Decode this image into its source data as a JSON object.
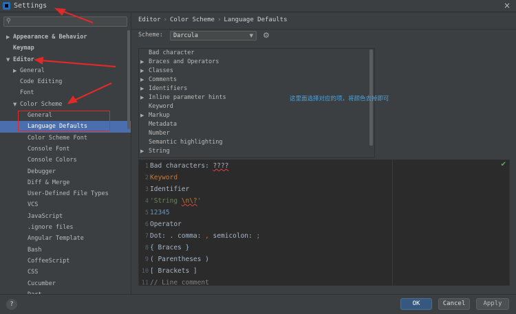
{
  "window": {
    "title": "Settings"
  },
  "sidebar": {
    "search_placeholder": "",
    "items": [
      {
        "label": "Appearance & Behavior",
        "indent": 0,
        "arrow": "▶",
        "bold": true
      },
      {
        "label": "Keymap",
        "indent": 0,
        "arrow": "",
        "bold": true
      },
      {
        "label": "Editor",
        "indent": 0,
        "arrow": "▼",
        "bold": true
      },
      {
        "label": "General",
        "indent": 1,
        "arrow": "▶",
        "bold": false
      },
      {
        "label": "Code Editing",
        "indent": 1,
        "arrow": "",
        "bold": false
      },
      {
        "label": "Font",
        "indent": 1,
        "arrow": "",
        "bold": false
      },
      {
        "label": "Color Scheme",
        "indent": 1,
        "arrow": "▼",
        "bold": false
      },
      {
        "label": "General",
        "indent": 2,
        "arrow": "",
        "bold": false
      },
      {
        "label": "Language Defaults",
        "indent": 2,
        "arrow": "",
        "bold": false,
        "selected": true
      },
      {
        "label": "Color Scheme Font",
        "indent": 2,
        "arrow": "",
        "bold": false
      },
      {
        "label": "Console Font",
        "indent": 2,
        "arrow": "",
        "bold": false
      },
      {
        "label": "Console Colors",
        "indent": 2,
        "arrow": "",
        "bold": false
      },
      {
        "label": "Debugger",
        "indent": 2,
        "arrow": "",
        "bold": false
      },
      {
        "label": "Diff & Merge",
        "indent": 2,
        "arrow": "",
        "bold": false
      },
      {
        "label": "User-Defined File Types",
        "indent": 2,
        "arrow": "",
        "bold": false
      },
      {
        "label": "VCS",
        "indent": 2,
        "arrow": "",
        "bold": false
      },
      {
        "label": "JavaScript",
        "indent": 2,
        "arrow": "",
        "bold": false
      },
      {
        "label": ".ignore files",
        "indent": 2,
        "arrow": "",
        "bold": false
      },
      {
        "label": "Angular Template",
        "indent": 2,
        "arrow": "",
        "bold": false
      },
      {
        "label": "Bash",
        "indent": 2,
        "arrow": "",
        "bold": false
      },
      {
        "label": "CoffeeScript",
        "indent": 2,
        "arrow": "",
        "bold": false
      },
      {
        "label": "CSS",
        "indent": 2,
        "arrow": "",
        "bold": false
      },
      {
        "label": "Cucumber",
        "indent": 2,
        "arrow": "",
        "bold": false
      },
      {
        "label": "Dart",
        "indent": 2,
        "arrow": "",
        "bold": false
      }
    ]
  },
  "breadcrumb": [
    "Editor",
    "Color Scheme",
    "Language Defaults"
  ],
  "scheme": {
    "label": "Scheme:",
    "value": "Darcula"
  },
  "categories": [
    {
      "label": "Bad character",
      "expandable": false
    },
    {
      "label": "Braces and Operators",
      "expandable": true
    },
    {
      "label": "Classes",
      "expandable": true
    },
    {
      "label": "Comments",
      "expandable": true
    },
    {
      "label": "Identifiers",
      "expandable": true
    },
    {
      "label": "Inline parameter hints",
      "expandable": true
    },
    {
      "label": "Keyword",
      "expandable": false
    },
    {
      "label": "Markup",
      "expandable": true
    },
    {
      "label": "Metadata",
      "expandable": false
    },
    {
      "label": "Number",
      "expandable": false
    },
    {
      "label": "Semantic highlighting",
      "expandable": false
    },
    {
      "label": "String",
      "expandable": true
    }
  ],
  "annotation": "这里面选择对应的项，将颜色去掉即可",
  "preview_lines": [
    {
      "n": "1",
      "parts": [
        [
          "Bad characters: ",
          "code"
        ],
        [
          "????",
          "code c-bad"
        ]
      ]
    },
    {
      "n": "2",
      "parts": [
        [
          "Keyword",
          "c-kw"
        ]
      ]
    },
    {
      "n": "3",
      "parts": [
        [
          "Identifier",
          "code"
        ]
      ]
    },
    {
      "n": "4",
      "parts": [
        [
          "'String ",
          "c-str"
        ],
        [
          "\\n\\?",
          "c-esc c-bad"
        ],
        [
          "'",
          "c-str"
        ]
      ]
    },
    {
      "n": "5",
      "parts": [
        [
          "12345",
          "c-num"
        ]
      ]
    },
    {
      "n": "6",
      "parts": [
        [
          "Operator",
          "code"
        ]
      ]
    },
    {
      "n": "7",
      "parts": [
        [
          "Dot: . comma: ",
          "code"
        ],
        [
          ",",
          "c-punct"
        ],
        [
          " semicolon: ",
          "code"
        ],
        [
          ";",
          "c-punct"
        ]
      ]
    },
    {
      "n": "8",
      "parts": [
        [
          "{ Braces }",
          "code"
        ]
      ]
    },
    {
      "n": "9",
      "parts": [
        [
          "( Parentheses )",
          "code"
        ]
      ]
    },
    {
      "n": "10",
      "parts": [
        [
          "[ Brackets ]",
          "code"
        ]
      ]
    },
    {
      "n": "11",
      "parts": [
        [
          "// Line comment",
          "c-com"
        ]
      ]
    }
  ],
  "buttons": {
    "help": "?",
    "ok": "OK",
    "cancel": "Cancel",
    "apply": "Apply"
  },
  "colors": {
    "accent": "#4b6eaf",
    "annotation_arrow": "#e02a2a",
    "ok_button": "#365880"
  }
}
